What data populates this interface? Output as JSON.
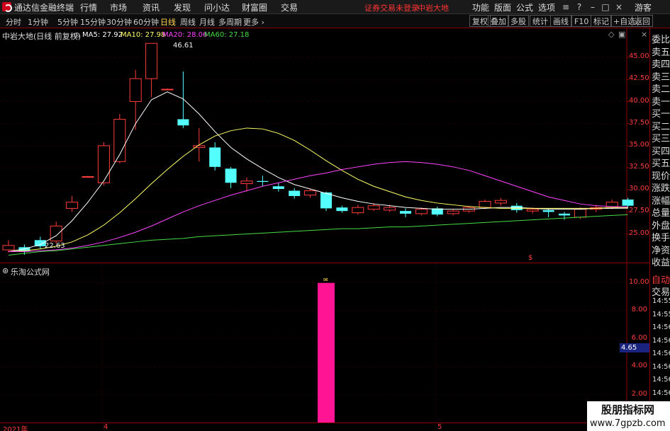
{
  "menubar": {
    "app_title": "通达信金融终端",
    "items": [
      "行情",
      "市场",
      "资讯",
      "发现",
      "问小达",
      "财富圈",
      "交易"
    ],
    "warning": "证券交易未登录",
    "stock_name": "中岩大地",
    "right_items": [
      "功能",
      "版面",
      "公式",
      "选项"
    ],
    "user": "游客"
  },
  "toolbar": {
    "periods": [
      "分时",
      "1分钟",
      "5分钟",
      "15分钟",
      "30分钟",
      "60分钟",
      "日线",
      "周线",
      "月线",
      "多周期",
      "更多"
    ],
    "active_period": "日线",
    "right_buttons": [
      "复权",
      "叠加",
      "多股",
      "统计",
      "画线",
      "F10",
      "标记",
      "+自选",
      "返回"
    ]
  },
  "main_chart": {
    "title": "中岩大地(日线 前复权)",
    "ma_labels": [
      {
        "text": "MA5: 27.92",
        "color": "#ffffff"
      },
      {
        "text": "MA10: 27.98",
        "color": "#ffff66"
      },
      {
        "text": "MA20: 28.06",
        "color": "#ff44ff"
      },
      {
        "text": "MA60: 27.18",
        "color": "#44dd44"
      }
    ],
    "high_label": "46.61",
    "low_label": "22.63",
    "marker": "$"
  },
  "indicator": {
    "title": "乐淘公式网",
    "cursor_value": "4.65"
  },
  "side_panel": {
    "items": [
      "委比",
      "卖五",
      "卖四",
      "卖三",
      "卖二",
      "卖一",
      "买一",
      "买二",
      "买三",
      "买四",
      "买五",
      "现价",
      "涨跌",
      "涨幅",
      "总量",
      "外盘",
      "换手",
      "净资",
      "收益"
    ],
    "auto_label": "自动",
    "trade_label": "交易",
    "times": [
      "14:55",
      "14:55",
      "14:56",
      "14:56",
      "14:56",
      "14:56",
      "14:56",
      "14:56",
      "14:56"
    ]
  },
  "x_axis": {
    "labels": [
      "2021年",
      "4",
      "5"
    ]
  },
  "watermark": {
    "line1": "股朋指标网",
    "line2": "www.7gpzb.com"
  },
  "colors": {
    "up": "#ff3b3b",
    "down": "#54ffff",
    "indicator_bar": "#ff1493",
    "panel_border": "#8b0000"
  },
  "chart_data": [
    {
      "type": "candlestick",
      "title": "中岩大地(日线 前复权)",
      "y_ticks": [
        45.0,
        42.5,
        40.0,
        37.5,
        35.0,
        32.5,
        30.0,
        27.5,
        25.0
      ],
      "ylim": [
        22.0,
        47.5
      ],
      "candles": [
        {
          "o": 23.2,
          "c": 23.7,
          "h": 24.3,
          "l": 22.9,
          "dir": "up"
        },
        {
          "o": 23.5,
          "c": 23.0,
          "h": 23.8,
          "l": 22.63,
          "dir": "down"
        },
        {
          "o": 23.6,
          "c": 24.3,
          "h": 24.7,
          "l": 23.3,
          "dir": "down"
        },
        {
          "o": 24.2,
          "c": 25.9,
          "h": 26.4,
          "l": 23.9,
          "dir": "up"
        },
        {
          "o": 27.9,
          "c": 28.6,
          "h": 29.3,
          "l": 27.5,
          "dir": "up"
        },
        {
          "o": 31.5,
          "c": 31.5,
          "h": 31.6,
          "l": 31.4,
          "dir": "up"
        },
        {
          "o": 30.8,
          "c": 35.0,
          "h": 35.4,
          "l": 30.5,
          "dir": "up"
        },
        {
          "o": 33.2,
          "c": 38.0,
          "h": 38.6,
          "l": 33.0,
          "dir": "up"
        },
        {
          "o": 40.0,
          "c": 42.6,
          "h": 43.6,
          "l": 36.8,
          "dir": "up"
        },
        {
          "o": 42.6,
          "c": 46.6,
          "h": 46.61,
          "l": 40.5,
          "dir": "up"
        },
        {
          "o": 41.4,
          "c": 41.4,
          "h": 41.5,
          "l": 41.3,
          "dir": "up"
        },
        {
          "o": 38.0,
          "c": 37.3,
          "h": 43.4,
          "l": 37.0,
          "dir": "down"
        },
        {
          "o": 35.0,
          "c": 34.8,
          "h": 37.0,
          "l": 33.2,
          "dir": "up"
        },
        {
          "o": 34.8,
          "c": 32.6,
          "h": 35.4,
          "l": 32.2,
          "dir": "down"
        },
        {
          "o": 32.4,
          "c": 30.8,
          "h": 32.6,
          "l": 30.2,
          "dir": "down"
        },
        {
          "o": 31.0,
          "c": 30.7,
          "h": 31.4,
          "l": 29.8,
          "dir": "up"
        },
        {
          "o": 31.0,
          "c": 30.9,
          "h": 31.6,
          "l": 30.4,
          "dir": "down"
        },
        {
          "o": 30.4,
          "c": 30.1,
          "h": 30.8,
          "l": 29.8,
          "dir": "down"
        },
        {
          "o": 29.9,
          "c": 29.3,
          "h": 30.2,
          "l": 29.0,
          "dir": "down"
        },
        {
          "o": 29.4,
          "c": 29.9,
          "h": 30.1,
          "l": 29.1,
          "dir": "up"
        },
        {
          "o": 29.7,
          "c": 27.9,
          "h": 29.8,
          "l": 27.6,
          "dir": "down"
        },
        {
          "o": 28.0,
          "c": 27.6,
          "h": 28.2,
          "l": 27.4,
          "dir": "down"
        },
        {
          "o": 27.4,
          "c": 28.0,
          "h": 28.3,
          "l": 27.2,
          "dir": "up"
        },
        {
          "o": 27.8,
          "c": 28.2,
          "h": 28.5,
          "l": 27.6,
          "dir": "up"
        },
        {
          "o": 28.0,
          "c": 27.7,
          "h": 28.3,
          "l": 27.5,
          "dir": "up"
        },
        {
          "o": 27.6,
          "c": 27.3,
          "h": 27.9,
          "l": 26.9,
          "dir": "down"
        },
        {
          "o": 27.3,
          "c": 27.8,
          "h": 28.0,
          "l": 27.1,
          "dir": "up"
        },
        {
          "o": 27.9,
          "c": 27.2,
          "h": 28.1,
          "l": 27.0,
          "dir": "down"
        },
        {
          "o": 27.3,
          "c": 27.6,
          "h": 27.8,
          "l": 27.1,
          "dir": "up"
        },
        {
          "o": 27.6,
          "c": 28.0,
          "h": 28.2,
          "l": 27.4,
          "dir": "up"
        },
        {
          "o": 28.0,
          "c": 28.7,
          "h": 28.9,
          "l": 27.8,
          "dir": "up"
        },
        {
          "o": 28.5,
          "c": 28.8,
          "h": 29.1,
          "l": 28.2,
          "dir": "up"
        },
        {
          "o": 28.2,
          "c": 27.7,
          "h": 28.5,
          "l": 27.4,
          "dir": "down"
        },
        {
          "o": 27.8,
          "c": 27.6,
          "h": 28.0,
          "l": 27.3,
          "dir": "up"
        },
        {
          "o": 27.7,
          "c": 27.5,
          "h": 27.9,
          "l": 26.9,
          "dir": "down"
        },
        {
          "o": 27.3,
          "c": 27.1,
          "h": 27.5,
          "l": 26.6,
          "dir": "down"
        },
        {
          "o": 26.9,
          "c": 27.8,
          "h": 28.0,
          "l": 26.7,
          "dir": "up"
        },
        {
          "o": 27.8,
          "c": 28.0,
          "h": 28.3,
          "l": 27.5,
          "dir": "up"
        },
        {
          "o": 28.0,
          "c": 28.6,
          "h": 28.9,
          "l": 27.8,
          "dir": "up"
        },
        {
          "o": 28.2,
          "c": 28.9,
          "h": 29.1,
          "l": 27.9,
          "dir": "down"
        }
      ],
      "ma_series": [
        {
          "name": "MA5",
          "color": "#ffffff",
          "values": [
            23.0,
            23.3,
            23.8,
            24.8,
            26.5,
            28.6,
            31.0,
            34.0,
            37.5,
            40.2,
            41.1,
            40.3,
            38.6,
            36.6,
            34.8,
            33.5,
            32.4,
            31.4,
            30.6,
            30.1,
            29.6,
            29.1,
            28.7,
            28.4,
            28.2,
            28.0,
            27.9,
            27.8,
            27.8,
            27.8,
            27.9,
            28.0,
            28.0,
            27.9,
            27.8,
            27.8,
            27.8,
            27.9,
            27.9,
            27.92
          ]
        },
        {
          "name": "MA10",
          "color": "#ffff66",
          "values": [
            23.0,
            23.1,
            23.3,
            23.6,
            24.1,
            24.9,
            26.0,
            27.4,
            29.0,
            30.7,
            32.3,
            33.8,
            35.1,
            36.1,
            36.7,
            37.0,
            36.9,
            36.4,
            35.6,
            34.5,
            33.3,
            32.2,
            31.2,
            30.4,
            29.8,
            29.2,
            28.8,
            28.5,
            28.3,
            28.1,
            28.0,
            27.9,
            27.9,
            27.9,
            27.9,
            27.9,
            27.9,
            27.9,
            28.0,
            27.98
          ]
        },
        {
          "name": "MA20",
          "color": "#ff44ff",
          "values": [
            23.0,
            23.0,
            23.1,
            23.2,
            23.4,
            23.7,
            24.1,
            24.6,
            25.2,
            25.9,
            26.7,
            27.5,
            28.2,
            28.8,
            29.4,
            29.9,
            30.4,
            30.8,
            31.2,
            31.6,
            31.9,
            32.3,
            32.6,
            32.9,
            33.1,
            33.2,
            33.1,
            32.9,
            32.6,
            32.2,
            31.6,
            31.0,
            30.4,
            29.8,
            29.2,
            28.8,
            28.4,
            28.2,
            28.1,
            28.06
          ]
        },
        {
          "name": "MA60",
          "color": "#44dd44",
          "values": [
            22.6,
            22.8,
            23.0,
            23.1,
            23.3,
            23.5,
            23.7,
            23.9,
            24.1,
            24.3,
            24.4,
            24.5,
            24.7,
            24.8,
            24.9,
            25.0,
            25.1,
            25.2,
            25.3,
            25.4,
            25.5,
            25.6,
            25.6,
            25.7,
            25.8,
            25.8,
            25.9,
            26.0,
            26.1,
            26.2,
            26.3,
            26.4,
            26.5,
            26.6,
            26.7,
            26.8,
            26.9,
            27.0,
            27.1,
            27.18
          ]
        }
      ]
    },
    {
      "type": "bar",
      "title": "乐淘公式网",
      "y_ticks": [
        10.0,
        8.0,
        6.0,
        4.0,
        2.0
      ],
      "ylim": [
        0,
        11
      ],
      "bars": [
        {
          "index": 20,
          "value": 10.0
        }
      ],
      "color": "#ff1493"
    }
  ]
}
